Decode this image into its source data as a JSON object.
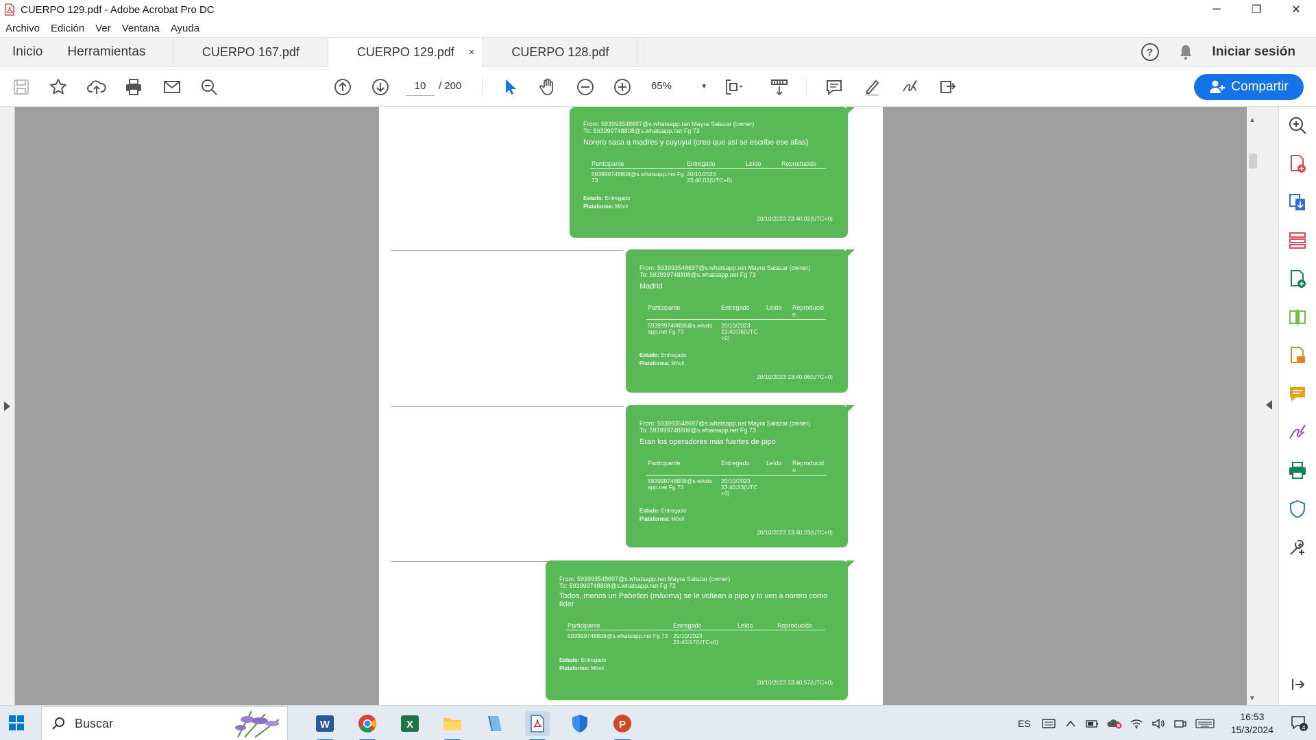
{
  "window": {
    "title": "CUERPO 129.pdf - Adobe Acrobat Pro DC",
    "controls": {
      "minimize": "─",
      "restore": "❐",
      "close": "✕"
    }
  },
  "menu": {
    "items": [
      {
        "label": "Archivo",
        "key": "A"
      },
      {
        "label": "Edición",
        "key": "E"
      },
      {
        "label": "Ver",
        "key": "V"
      },
      {
        "label": "Ventana",
        "key": "n"
      },
      {
        "label": "Ayuda",
        "key": "y"
      }
    ]
  },
  "tabs": {
    "home": "Inicio",
    "tools": "Herramientas",
    "docs": [
      {
        "label": "CUERPO 167.pdf"
      },
      {
        "label": "CUERPO 129.pdf",
        "active": true,
        "close": "×"
      },
      {
        "label": "CUERPO 128.pdf"
      }
    ],
    "signin": "Iniciar sesión",
    "help": "?"
  },
  "toolbar": {
    "page_current": "10",
    "page_total": "/  200",
    "zoom": "65%",
    "zoom_caret": "▾",
    "share_label": "Compartir",
    "icons": [
      "save-icon",
      "star-icon",
      "upload-icon",
      "print-icon",
      "mail-icon",
      "search-zoom-icon",
      "page-up-icon",
      "page-down-icon",
      "select-cursor-icon",
      "hand-icon",
      "zoom-out-icon",
      "zoom-in-icon",
      "fit-page-icon",
      "scroll-mode-icon",
      "comment-icon",
      "highlight-icon",
      "sign-icon",
      "more-tools-icon"
    ]
  },
  "messages": [
    {
      "from": "From: 593993548697@s.whatsapp.net Mayra Salazar (owner)",
      "to": "To: 593999748808@s.whatsapp.net Fg 73",
      "text": "Norero saca a madres y cuyuyui (creo que así se escribe ese alias)",
      "headers": [
        "Participante",
        "Entregado",
        "Leído",
        "Reproducido"
      ],
      "participant": "593999748808@s.whatsapp.net Fg 73",
      "delivered": "20/10/2023 23:40:02(UTC+0)",
      "estado_label": "Estado:",
      "estado": "Entregado",
      "plataforma_label": "Plataforma:",
      "plataforma": "Móvil",
      "stamp": "20/10/2023 23:40:02(UTC+0)"
    },
    {
      "from": "From: 593993548697@s.whatsapp.net Mayra Salazar (owner)",
      "to": "To: 593999748808@s.whatsapp.net Fg 73",
      "text": "Madrid",
      "headers": [
        "Participante",
        "Entregado",
        "Leído",
        "Reproducid o"
      ],
      "participant": "593999748808@s.whats app.net Fg 73",
      "delivered": "20/10/2023 23:40:06(UTC +0)",
      "estado_label": "Estado:",
      "estado": "Entregado",
      "plataforma_label": "Plataforma:",
      "plataforma": "Móvil",
      "stamp": "20/10/2023 23:40:06(UTC+0)"
    },
    {
      "from": "From: 593993548697@s.whatsapp.net Mayra Salazar (owner)",
      "to": "To: 593999748808@s.whatsapp.net Fg 73",
      "text": "Eran los operadores más fuertes de pipo",
      "headers": [
        "Participante",
        "Entregado",
        "Leído",
        "Reproducid o"
      ],
      "participant": "593999748808@s.whats app.net Fg 73",
      "delivered": "20/10/2023 23:40:23(UTC +0)",
      "estado_label": "Estado:",
      "estado": "Entregado",
      "plataforma_label": "Plataforma:",
      "plataforma": "Móvil",
      "stamp": "20/10/2023 23:40:23(UTC+0)"
    },
    {
      "from": "From: 593993548697@s.whatsapp.net Mayra Salazar (owner)",
      "to": "To: 593999748808@s.whatsapp.net Fg 73",
      "text": "Todos, menos un Pabellon (máxima) se le voltean a pipo y lo ven a norero como líder",
      "headers": [
        "Participante",
        "Entregado",
        "Leído",
        "Reproducido"
      ],
      "participant": "593999748808@s.whatsapp.net Fg 73",
      "delivered": "20/10/2023 23:40:57(UTC+0)",
      "estado_label": "Estado:",
      "estado": "Entregado",
      "plataforma_label": "Plataforma:",
      "plataforma": "Móvil",
      "stamp": "20/10/2023 23:40:57(UTC+0)"
    }
  ],
  "taskbar": {
    "search_label": "Buscar",
    "apps": [
      "word-icon",
      "chrome-icon",
      "excel-icon",
      "file-explorer-icon",
      "notepad-icon",
      "acrobat-icon",
      "defender-icon",
      "powerpoint-icon"
    ],
    "lang": "ES",
    "time": "16:53",
    "date": "15/3/2024",
    "notifications": "4"
  },
  "colors": {
    "bubble": "#58b956",
    "accent": "#1473e6",
    "viewer_bg": "#9f9f9f"
  }
}
